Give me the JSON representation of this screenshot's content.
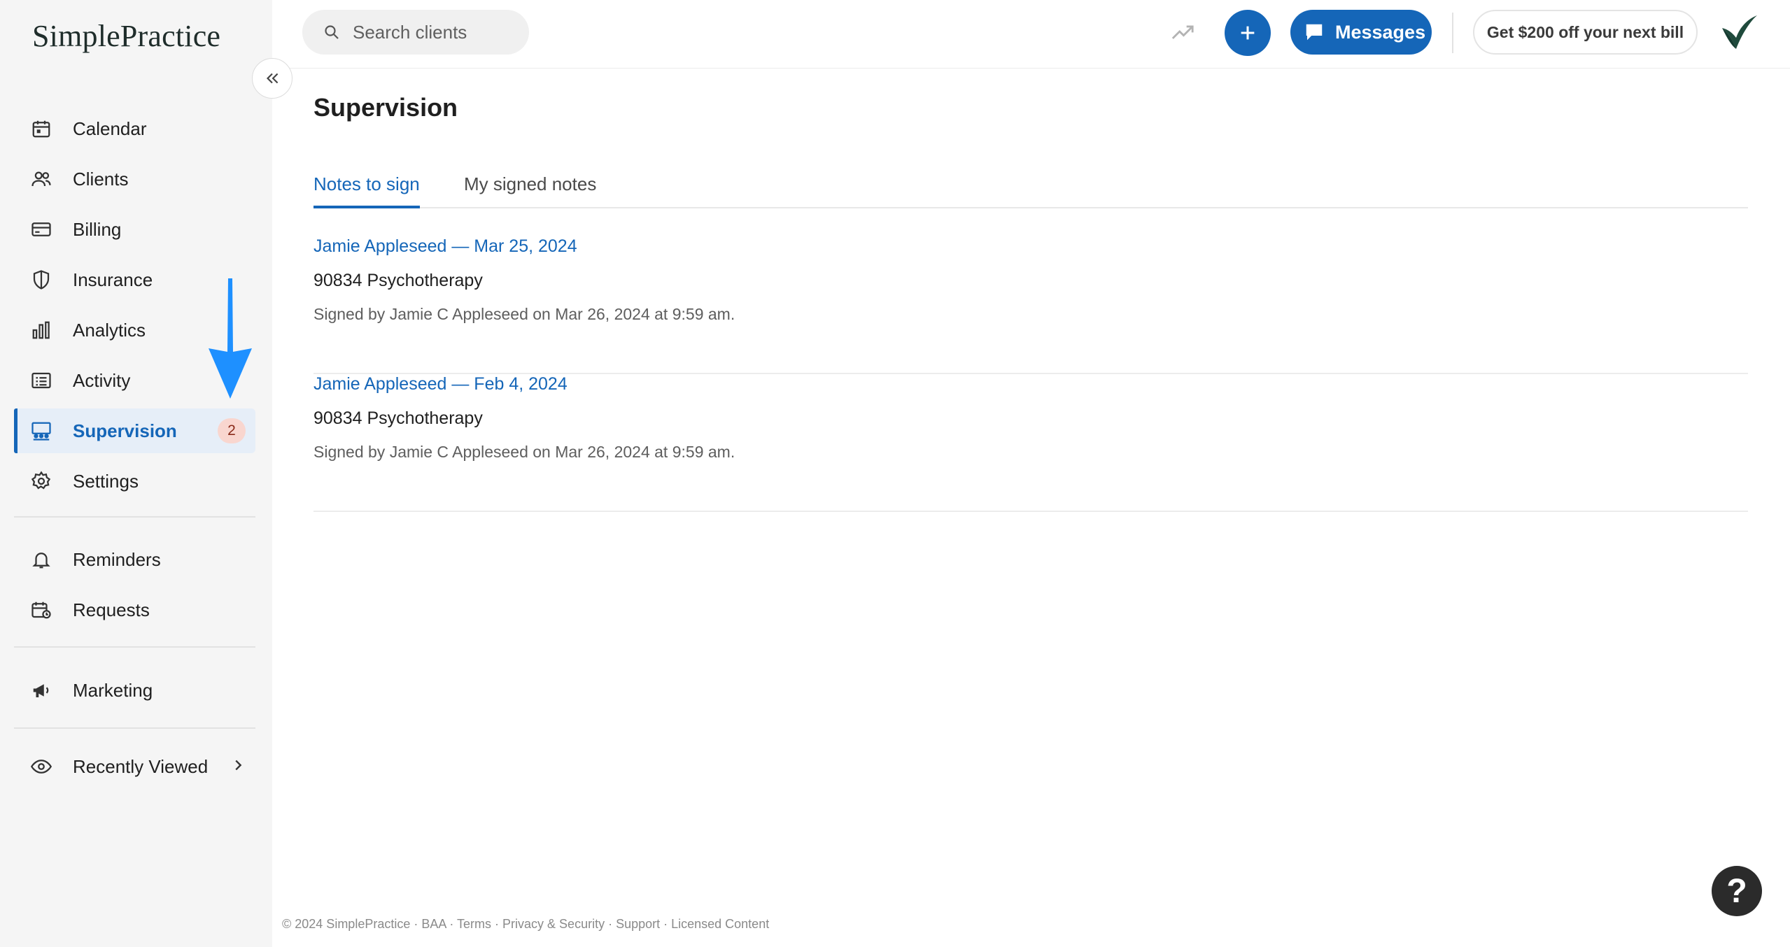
{
  "brand": {
    "logo_text": "SimplePractice"
  },
  "sidebar": {
    "items": [
      {
        "label": "Calendar",
        "icon": "calendar-icon"
      },
      {
        "label": "Clients",
        "icon": "clients-icon"
      },
      {
        "label": "Billing",
        "icon": "billing-card-icon"
      },
      {
        "label": "Insurance",
        "icon": "shield-icon"
      },
      {
        "label": "Analytics",
        "icon": "bar-chart-icon"
      },
      {
        "label": "Activity",
        "icon": "list-icon"
      },
      {
        "label": "Supervision",
        "icon": "supervision-icon",
        "badge": "2",
        "active": true
      },
      {
        "label": "Settings",
        "icon": "gear-icon"
      },
      {
        "label": "Reminders",
        "icon": "bell-icon"
      },
      {
        "label": "Requests",
        "icon": "calendar-request-icon"
      },
      {
        "label": "Marketing",
        "icon": "megaphone-icon"
      },
      {
        "label": "Recently Viewed",
        "icon": "eye-icon"
      }
    ]
  },
  "topbar": {
    "search_placeholder": "Search clients",
    "messages_label": "Messages",
    "promo_label": "Get $200 off your next bill"
  },
  "main": {
    "title": "Supervision",
    "tabs": [
      {
        "label": "Notes to sign",
        "active": true
      },
      {
        "label": "My signed notes",
        "active": false
      }
    ],
    "notes": [
      {
        "title": "Jamie Appleseed — Mar 25, 2024",
        "code": "90834 Psychotherapy",
        "signed": "Signed by Jamie C Appleseed on Mar 26, 2024 at 9:59 am."
      },
      {
        "title": "Jamie Appleseed — Feb 4, 2024",
        "code": "90834 Psychotherapy",
        "signed": "Signed by Jamie C Appleseed on Mar 26, 2024 at 9:59 am."
      }
    ]
  },
  "footer": {
    "text": "© 2024 SimplePractice · BAA · Terms · Privacy & Security · Support · Licensed Content"
  },
  "help": {
    "label": "?"
  },
  "colors": {
    "accent": "#1566b8",
    "sidebar_bg": "#f5f5f5",
    "badge_bg": "#f9d6cf",
    "arrow": "#1e90ff"
  }
}
